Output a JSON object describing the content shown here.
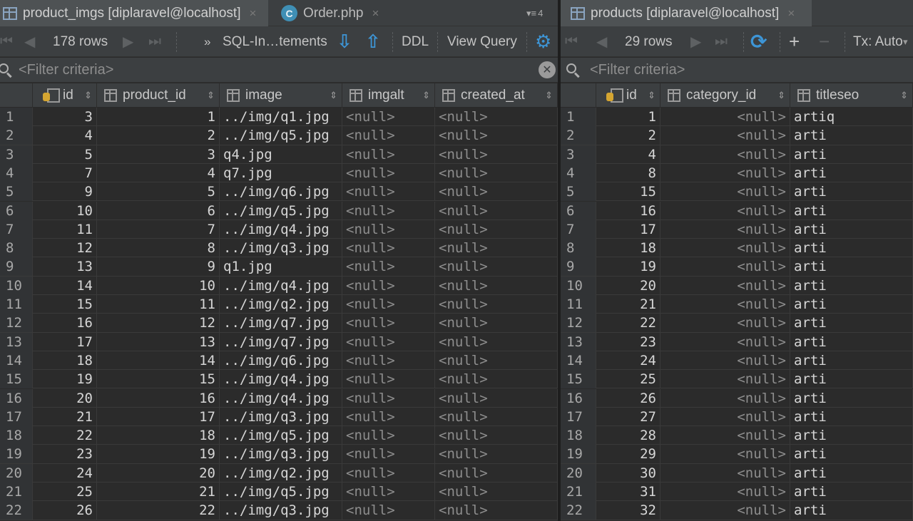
{
  "left": {
    "tabs": [
      {
        "label": "product_imgs [diplaravel@localhost]",
        "close": "×"
      },
      {
        "label": "Order.php",
        "close": "×"
      }
    ],
    "tab_overflow": "4",
    "toolbar": {
      "rows": "178 rows",
      "sql_label": "SQL-In…tements",
      "ddl": "DDL",
      "view_query": "View Query"
    },
    "filter_placeholder": "<Filter criteria>",
    "columns": [
      "id",
      "product_id",
      "image",
      "imgalt",
      "created_at"
    ],
    "rows": [
      [
        "1",
        "3",
        "1",
        "../img/q1.jpg",
        "<null>",
        "<null>"
      ],
      [
        "2",
        "4",
        "2",
        "../img/q5.jpg",
        "<null>",
        "<null>"
      ],
      [
        "3",
        "5",
        "3",
        "q4.jpg",
        "<null>",
        "<null>"
      ],
      [
        "4",
        "7",
        "4",
        "q7.jpg",
        "<null>",
        "<null>"
      ],
      [
        "5",
        "9",
        "5",
        "../img/q6.jpg",
        "<null>",
        "<null>"
      ],
      [
        "6",
        "10",
        "6",
        "../img/q5.jpg",
        "<null>",
        "<null>"
      ],
      [
        "7",
        "11",
        "7",
        "../img/q4.jpg",
        "<null>",
        "<null>"
      ],
      [
        "8",
        "12",
        "8",
        "../img/q3.jpg",
        "<null>",
        "<null>"
      ],
      [
        "9",
        "13",
        "9",
        "q1.jpg",
        "<null>",
        "<null>"
      ],
      [
        "10",
        "14",
        "10",
        "../img/q4.jpg",
        "<null>",
        "<null>"
      ],
      [
        "11",
        "15",
        "11",
        "../img/q2.jpg",
        "<null>",
        "<null>"
      ],
      [
        "12",
        "16",
        "12",
        "../img/q7.jpg",
        "<null>",
        "<null>"
      ],
      [
        "13",
        "17",
        "13",
        "../img/q7.jpg",
        "<null>",
        "<null>"
      ],
      [
        "14",
        "18",
        "14",
        "../img/q6.jpg",
        "<null>",
        "<null>"
      ],
      [
        "15",
        "19",
        "15",
        "../img/q4.jpg",
        "<null>",
        "<null>"
      ],
      [
        "16",
        "20",
        "16",
        "../img/q4.jpg",
        "<null>",
        "<null>"
      ],
      [
        "17",
        "21",
        "17",
        "../img/q3.jpg",
        "<null>",
        "<null>"
      ],
      [
        "18",
        "22",
        "18",
        "../img/q5.jpg",
        "<null>",
        "<null>"
      ],
      [
        "19",
        "23",
        "19",
        "../img/q3.jpg",
        "<null>",
        "<null>"
      ],
      [
        "20",
        "24",
        "20",
        "../img/q2.jpg",
        "<null>",
        "<null>"
      ],
      [
        "21",
        "25",
        "21",
        "../img/q5.jpg",
        "<null>",
        "<null>"
      ],
      [
        "22",
        "26",
        "22",
        "../img/q3.jpg",
        "<null>",
        "<null>"
      ]
    ]
  },
  "right": {
    "tabs": [
      {
        "label": "products [diplaravel@localhost]",
        "close": "×"
      }
    ],
    "toolbar": {
      "rows": "29 rows",
      "add": "+",
      "remove": "−",
      "tx": "Tx: Auto"
    },
    "filter_placeholder": "<Filter criteria>",
    "columns": [
      "id",
      "category_id",
      "titleseo"
    ],
    "rows": [
      [
        "1",
        "1",
        "<null>",
        "artiq"
      ],
      [
        "2",
        "2",
        "<null>",
        "arti"
      ],
      [
        "3",
        "4",
        "<null>",
        "arti"
      ],
      [
        "4",
        "8",
        "<null>",
        "arti"
      ],
      [
        "5",
        "15",
        "<null>",
        "arti"
      ],
      [
        "6",
        "16",
        "<null>",
        "arti"
      ],
      [
        "7",
        "17",
        "<null>",
        "arti"
      ],
      [
        "8",
        "18",
        "<null>",
        "arti"
      ],
      [
        "9",
        "19",
        "<null>",
        "arti"
      ],
      [
        "10",
        "20",
        "<null>",
        "arti"
      ],
      [
        "11",
        "21",
        "<null>",
        "arti"
      ],
      [
        "12",
        "22",
        "<null>",
        "arti"
      ],
      [
        "13",
        "23",
        "<null>",
        "arti"
      ],
      [
        "14",
        "24",
        "<null>",
        "arti"
      ],
      [
        "15",
        "25",
        "<null>",
        "arti"
      ],
      [
        "16",
        "26",
        "<null>",
        "arti"
      ],
      [
        "17",
        "27",
        "<null>",
        "arti"
      ],
      [
        "18",
        "28",
        "<null>",
        "arti"
      ],
      [
        "19",
        "29",
        "<null>",
        "arti"
      ],
      [
        "20",
        "30",
        "<null>",
        "arti"
      ],
      [
        "21",
        "31",
        "<null>",
        "arti"
      ],
      [
        "22",
        "32",
        "<null>",
        "arti"
      ]
    ]
  },
  "icons": {
    "table_tab": "table-grid-icon",
    "php_file": "php-class-icon",
    "nav_first": "⏮",
    "nav_prev": "◀",
    "nav_next": "▶",
    "nav_last": "⏭",
    "more": "»",
    "export": "⇩",
    "import": "⇧",
    "settings": "⚙",
    "refresh": "⟳"
  },
  "colors": {
    "background": "#2b2b2b",
    "toolbar": "#3c3f41",
    "accent_blue": "#3d95d6",
    "key_yellow": "#d4a531",
    "null_text": "#8d8d8d"
  }
}
